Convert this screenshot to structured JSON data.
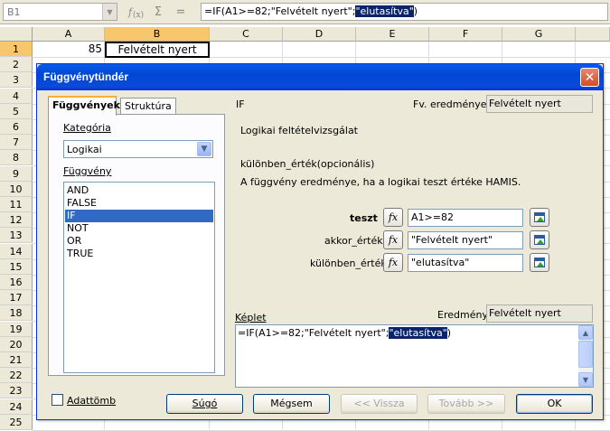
{
  "formula_bar": {
    "name_box": "B1",
    "icons": [
      "function-wizard-icon",
      "sum-icon",
      "equals-icon"
    ],
    "sum_glyph": "Σ",
    "equals_glyph": "=",
    "formula_prefix": "=IF(A1>=82;\"Felvételt nyert\";",
    "formula_selected": "\"elutasítva\"",
    "formula_suffix": ")"
  },
  "sheet": {
    "columns": [
      "A",
      "B",
      "C",
      "D",
      "E",
      "F",
      "G"
    ],
    "rows": [
      "1",
      "2",
      "3",
      "4",
      "5",
      "6",
      "7",
      "8",
      "9",
      "10",
      "11",
      "12",
      "13",
      "14",
      "15",
      "16",
      "17",
      "18",
      "19",
      "20",
      "21",
      "22",
      "23",
      "24",
      "25"
    ],
    "a1": "85",
    "b1": "Felvételt nyert"
  },
  "dialog": {
    "title": "Függvénytündér",
    "close_glyph": "✕",
    "tabs": [
      "Függvények",
      "Struktúra"
    ],
    "category_label": "Kategória",
    "category_value": "Logikai",
    "function_label": "Függvény",
    "functions": [
      "AND",
      "FALSE",
      "IF",
      "NOT",
      "OR",
      "TRUE"
    ],
    "selected_function": "IF",
    "array_label": "Adattömb",
    "function_name": "IF",
    "result_label": "Fv. eredménye:",
    "result_value": "Felvételt nyert",
    "description": "Logikai feltételvizsgálat",
    "param_name": "különben_érték(opcionális)",
    "param_desc": "A függvény eredménye, ha a logikai teszt értéke HAMIS.",
    "args": [
      {
        "label": "teszt",
        "value": "A1>=82"
      },
      {
        "label": "akkor_érték",
        "value": "\"Felvételt nyert\""
      },
      {
        "label": "különben_érték",
        "value": "\"elutasítva\""
      }
    ],
    "fx_glyph": "fx",
    "formula_label": "Képlet",
    "eredmeny_label": "Eredmény",
    "eredmeny_value": "Felvételt nyert",
    "formula_prefix": "=IF(A1>=82;\"Felvételt nyert\";",
    "formula_selected": "\"elutasítva\"",
    "formula_suffix": ")",
    "buttons": {
      "help": "Súgó",
      "cancel": "Mégsem",
      "back": "<< Vissza",
      "next": "Tovább >>",
      "ok": "OK"
    }
  }
}
